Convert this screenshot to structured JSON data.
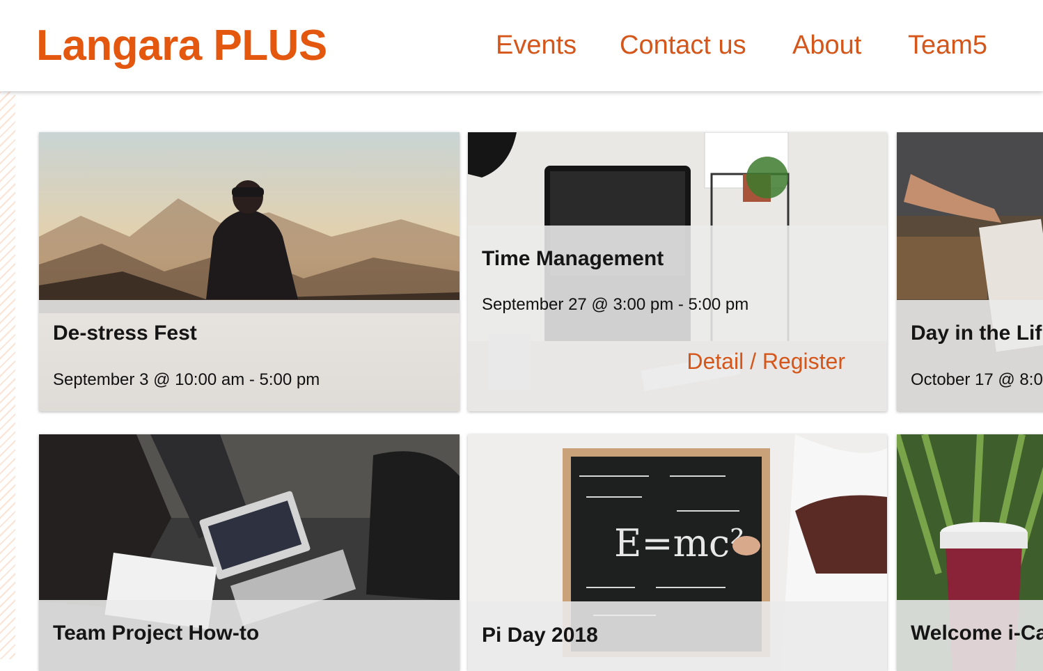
{
  "brand": "Langara PLUS",
  "nav": [
    "Events",
    "Contact us",
    "About",
    "Team5"
  ],
  "cards": [
    {
      "title": "De-stress Fest",
      "date": "September 3 @ 10:00 am - 5:00 pm"
    },
    {
      "title": "Time Management",
      "date": "September 27 @ 3:00 pm - 5:00 pm",
      "link": "Detail / Register"
    },
    {
      "title": "Day in the Lif",
      "date": "October 17 @ 8:0"
    },
    {
      "title": "Team Project How-to"
    },
    {
      "title": "Pi Day 2018"
    },
    {
      "title": "Welcome i-Ca"
    }
  ],
  "colors": {
    "accent": "#e4570f",
    "link": "#d4561a",
    "panel": "#eaeaea"
  }
}
